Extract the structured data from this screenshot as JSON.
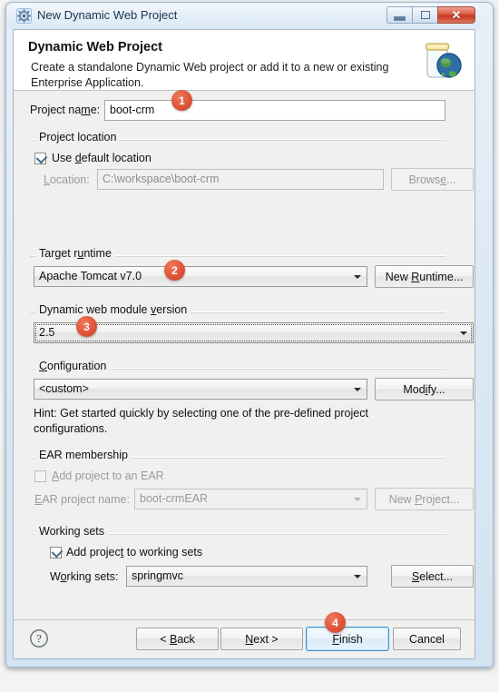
{
  "window": {
    "title": "New Dynamic Web Project",
    "icon": "gear-icon",
    "minimize_label": "Minimize",
    "maximize_label": "Maximize",
    "close_label": "Close"
  },
  "banner": {
    "title": "Dynamic Web Project",
    "description": "Create a standalone Dynamic Web project or add it to a new or existing Enterprise Application.",
    "icon": "web-project-jar-globe-icon"
  },
  "form": {
    "project_name_label": "Project na",
    "project_name_label_acc": "m",
    "project_name_label_tail": "e:",
    "project_name_value": "boot-crm",
    "project_location": {
      "legend": "Project location",
      "use_default_pre": "Use ",
      "use_default_acc": "d",
      "use_default_post": "efault location",
      "use_default_checked": true,
      "location_label_acc": "L",
      "location_label_post": "ocation:",
      "location_value": "C:\\workspace\\boot-crm",
      "browse_pre": "Brows",
      "browse_acc": "e",
      "browse_post": "...",
      "browse_enabled": false
    },
    "target_runtime": {
      "legend_pre": "Target r",
      "legend_acc": "u",
      "legend_post": "ntime",
      "value": "Apache Tomcat v7.0",
      "new_runtime_pre": "New ",
      "new_runtime_acc": "R",
      "new_runtime_post": "untime..."
    },
    "module_version": {
      "legend_pre": "Dynamic web module ",
      "legend_acc": "v",
      "legend_post": "ersion",
      "value": "2.5",
      "focused": true
    },
    "configuration": {
      "legend_acc": "C",
      "legend_post": "onfiguration",
      "value": "<custom>",
      "modify_pre": "Mod",
      "modify_acc": "i",
      "modify_post": "fy...",
      "hint": "Hint: Get started quickly by selecting one of the pre-defined project configurations."
    },
    "ear_membership": {
      "legend": "EAR membership",
      "add_to_ear_acc": "A",
      "add_to_ear_post": "dd project to an EAR",
      "add_to_ear_checked": false,
      "ear_name_label_acc": "E",
      "ear_name_label_post": "AR project name:",
      "ear_name_value": "boot-crmEAR",
      "new_project_pre": "New ",
      "new_project_acc": "P",
      "new_project_post": "roject...",
      "enabled": false
    },
    "working_sets": {
      "legend": "Working sets",
      "add_to_ws_pre": "Add projec",
      "add_to_ws_acc": "t",
      "add_to_ws_post": " to working sets",
      "add_to_ws_checked": true,
      "ws_label_pre": "W",
      "ws_label_acc": "o",
      "ws_label_post": "rking sets:",
      "ws_value": "springmvc",
      "select_pre": "",
      "select_acc": "S",
      "select_post": "elect..."
    }
  },
  "buttons": {
    "help_icon": "question-mark-icon",
    "back_pre": "< ",
    "back_acc": "B",
    "back_post": "ack",
    "next_pre": "",
    "next_acc": "N",
    "next_post": "ext >",
    "finish_pre": "",
    "finish_acc": "F",
    "finish_post": "inish",
    "finish_focused": true,
    "cancel": "Cancel"
  },
  "markers": [
    {
      "number": "1",
      "target": "project-name-input"
    },
    {
      "number": "2",
      "target": "target-runtime-combo"
    },
    {
      "number": "3",
      "target": "module-version-combo"
    },
    {
      "number": "4",
      "target": "finish-button"
    }
  ],
  "colors": {
    "marker": "#e0563a",
    "dialog_bg": "#f0f0ee",
    "banner_bg": "#ffffff",
    "focus_blue": "#3c93d0",
    "close_red": "#c4351d"
  }
}
